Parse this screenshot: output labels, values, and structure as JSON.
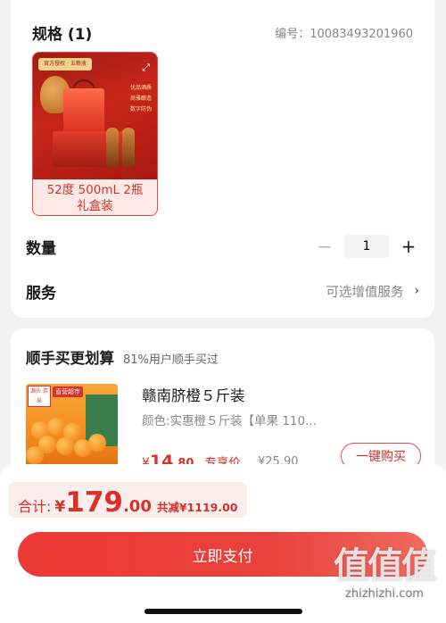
{
  "spec": {
    "title": "规格 (1)",
    "code_label": "编号：",
    "code_value": "10083493201960",
    "option": {
      "label_line1": "52度 500mL 2瓶",
      "label_line2": "礼盒装",
      "image": {
        "logo_text": "官方授权 · 五粮液",
        "tags": [
          "优品酒质",
          "尚雅酿造",
          "数字防伪"
        ]
      }
    }
  },
  "quantity": {
    "label": "数量",
    "minus": "−",
    "value": "1",
    "plus": "+"
  },
  "service": {
    "label": "服务",
    "value": "可选增值服务",
    "chevron": "›"
  },
  "bundle": {
    "title": "顺手买更划算",
    "subtitle": "81%用户顺手买过",
    "product": {
      "name": "赣南脐橙５斤装",
      "variant": "颜色:实惠橙５斤装【单果 110...",
      "price_currency": "¥",
      "price_int": "14",
      "price_dec": ".80",
      "price_tag": "专享价",
      "orig_price": "¥25.90",
      "buy_label": "一键购买",
      "image": {
        "badge": "源头 京采",
        "tag": "直营超市"
      }
    }
  },
  "total": {
    "label": "合计:",
    "currency": "¥",
    "int": "179",
    "dec": ".00",
    "discount": "共减¥1119.00"
  },
  "pay": {
    "label": "立即支付"
  },
  "watermark": {
    "logo": "值值值",
    "url": "zhizhizhi.com"
  },
  "colors": {
    "accent": "#d9302a",
    "pay_button": "#e8413b",
    "background": "#f2f2f2"
  }
}
